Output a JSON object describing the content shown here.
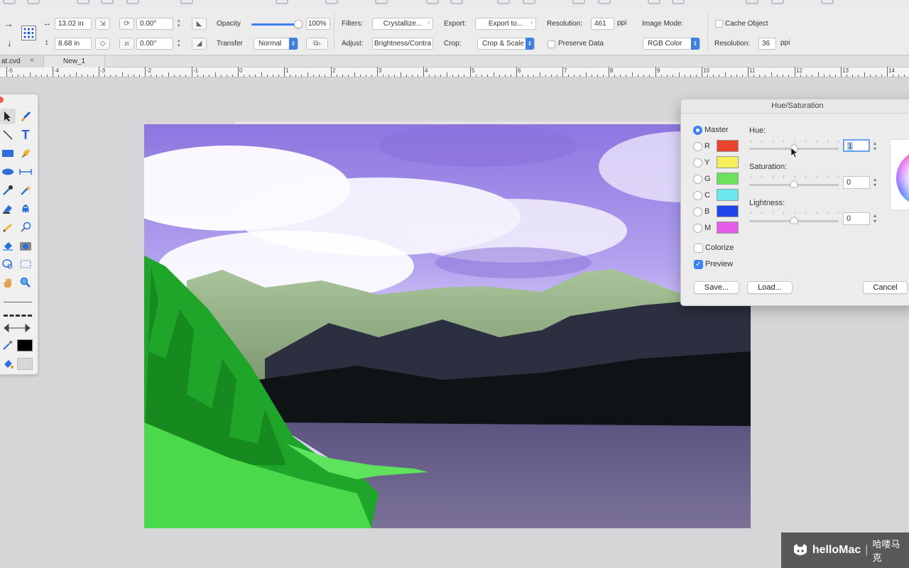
{
  "inspector": {
    "width_value": "13.02 in",
    "height_value": "8.68 in",
    "rotation_top": "0.00°",
    "rotation_bottom": "0.00°",
    "opacity_label": "Opacity",
    "opacity_value": "100%",
    "opacity_level": 1.0,
    "transfer_label": "Transfer",
    "transfer_value": "Normal",
    "filters_label": "Filters:",
    "filters_value": "Crystallize...",
    "adjust_label": "Adjust:",
    "adjust_value": "Brightness/Contra",
    "export_label": "Export:",
    "export_value": "Export to...",
    "crop_label": "Crop:",
    "crop_value": "Crop & Scale",
    "preserve_label": "Preserve Data",
    "resolution_label": "Resolution:",
    "resolution_value": "461",
    "resolution_unit": "ppi",
    "image_mode_label": "Image Mode:",
    "image_mode_value": "RGB Color",
    "cache_label": "Cache Object",
    "resolution2_label": "Resolution:",
    "resolution2_value": "36",
    "resolution2_unit": "ppi"
  },
  "tabs": [
    {
      "label": "at.cvd",
      "close": "×"
    },
    {
      "label": "New_1"
    }
  ],
  "ruler": {
    "labels": [
      "-5",
      "-4",
      "-3",
      "-2",
      "-1",
      "0",
      "1",
      "2",
      "3",
      "4",
      "5",
      "6",
      "7",
      "8",
      "9",
      "10",
      "11",
      "12",
      "13",
      "14"
    ]
  },
  "tools": {
    "icons": [
      "arrow-select-icon",
      "paintbrush-icon",
      "line-icon",
      "text-icon",
      "rectangle-icon",
      "pen-icon",
      "ellipse-icon",
      "dimension-icon",
      "eyedropper-icon",
      "magic-wand-icon",
      "eraser-icon",
      "clone-stamp-icon",
      "smudge-icon",
      "blur-icon",
      "fill-icon",
      "camera-icon",
      "lasso-icon",
      "marquee-icon",
      "hand-icon",
      "zoom-icon"
    ]
  },
  "dialog": {
    "title": "Hue/Saturation",
    "channels": [
      {
        "label": "Master",
        "selected": true
      },
      {
        "label": "R",
        "color": "#e8452c"
      },
      {
        "label": "Y",
        "color": "#f7ef59"
      },
      {
        "label": "G",
        "color": "#6be25b"
      },
      {
        "label": "C",
        "color": "#6ae8ee"
      },
      {
        "label": "B",
        "color": "#1f46e8"
      },
      {
        "label": "M",
        "color": "#e45ce8"
      }
    ],
    "hue_label": "Hue:",
    "hue_value": "1",
    "saturation_label": "Saturation:",
    "saturation_value": "0",
    "lightness_label": "Lightness:",
    "lightness_value": "0",
    "colorize_label": "Colorize",
    "preview_label": "Preview",
    "preview_checked": true,
    "save_label": "Save...",
    "load_label": "Load...",
    "cancel_label": "Cancel"
  },
  "watermark": {
    "brand": "helloMac",
    "separator": "|",
    "cn": "哈喽马克"
  },
  "colors": {
    "accent": "#3b82f0",
    "sky": "#9a86e6",
    "grass": "#33d23a",
    "water": "#6f6690"
  }
}
